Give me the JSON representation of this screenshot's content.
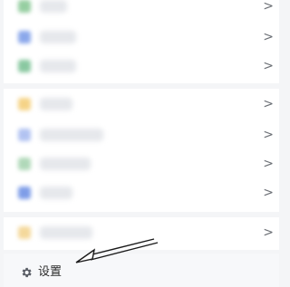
{
  "menu": {
    "group1": [
      {
        "icon": "green-app-icon",
        "color": "#7cc28a",
        "label": "",
        "chevron": ">"
      },
      {
        "icon": "blue-app-icon",
        "color": "#6f93e6",
        "label": "",
        "chevron": ">"
      },
      {
        "icon": "green-app-icon",
        "color": "#6dbb8a",
        "label": "",
        "chevron": ">"
      }
    ],
    "group2": [
      {
        "icon": "yellow-app-icon",
        "color": "#f3c96a",
        "label": "",
        "chevron": ">"
      },
      {
        "icon": "blue-app-icon",
        "color": "#9fb4ee",
        "label": "",
        "chevron": ">"
      },
      {
        "icon": "green-app-icon",
        "color": "#9dcfa8",
        "label": "",
        "chevron": ">"
      },
      {
        "icon": "blue-app-icon",
        "color": "#5f85e2",
        "label": "",
        "chevron": ">"
      }
    ],
    "group3": [
      {
        "icon": "yellow-app-icon",
        "color": "#f2cf83",
        "label": "",
        "chevron": ">"
      }
    ]
  },
  "settings": {
    "label": "设置",
    "icon": "gear-icon"
  }
}
